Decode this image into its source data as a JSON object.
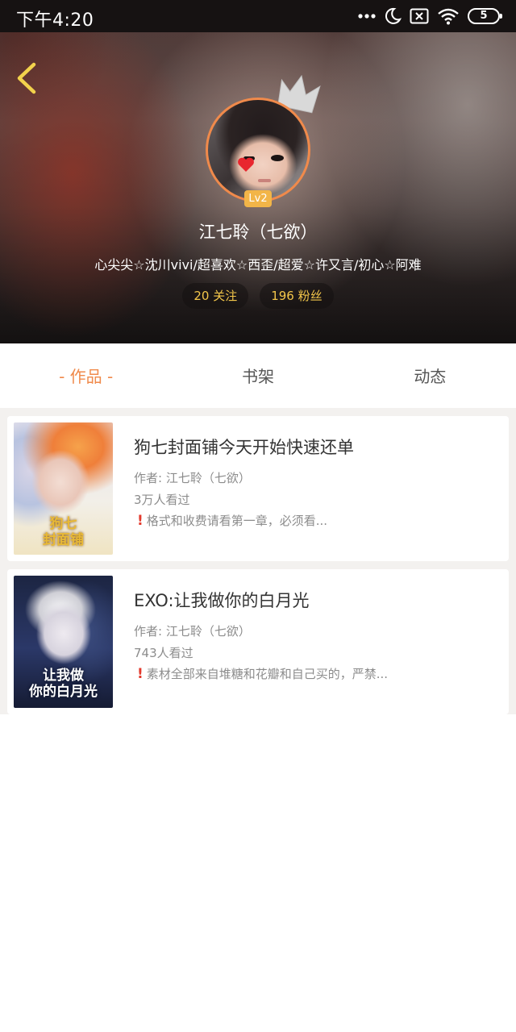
{
  "status_bar": {
    "time": "下午4:20",
    "battery": "5",
    "icons": [
      "more-dots-icon",
      "moon-icon",
      "sim-x-icon",
      "wifi-icon",
      "battery-icon"
    ]
  },
  "header": {
    "back_icon": "chevron-left-icon",
    "level_badge": "Lv2",
    "name": "江七聆（七欲）",
    "bio": "心尖尖☆沈川vivi/超喜欢☆西歪/超爱☆许又言/初心☆阿难",
    "follow": "20 关注",
    "fans": "196 粉丝"
  },
  "tabs": [
    {
      "label": "- 作品 -",
      "active": true
    },
    {
      "label": "书架",
      "active": false
    },
    {
      "label": "动态",
      "active": false
    }
  ],
  "books": [
    {
      "title": "狗七封面铺今天开始快速还单",
      "author": "作者: 江七聆（七欲）",
      "views": "3万人看过",
      "desc": "格式和收费请看第一章，必须看...",
      "cover_title": "狗七\n封面铺"
    },
    {
      "title": "EXO:让我做你的白月光",
      "author": "作者: 江七聆（七欲）",
      "views": "743人看过",
      "desc": "素材全部来自堆糖和花瓣和自己买的，严禁...",
      "cover_title": "让我做\n你的白月光"
    }
  ],
  "colors": {
    "accent": "#f08a4b",
    "pill_text": "#f3c64a",
    "level_badge": "#f2b548",
    "alert": "#e33b2e"
  }
}
